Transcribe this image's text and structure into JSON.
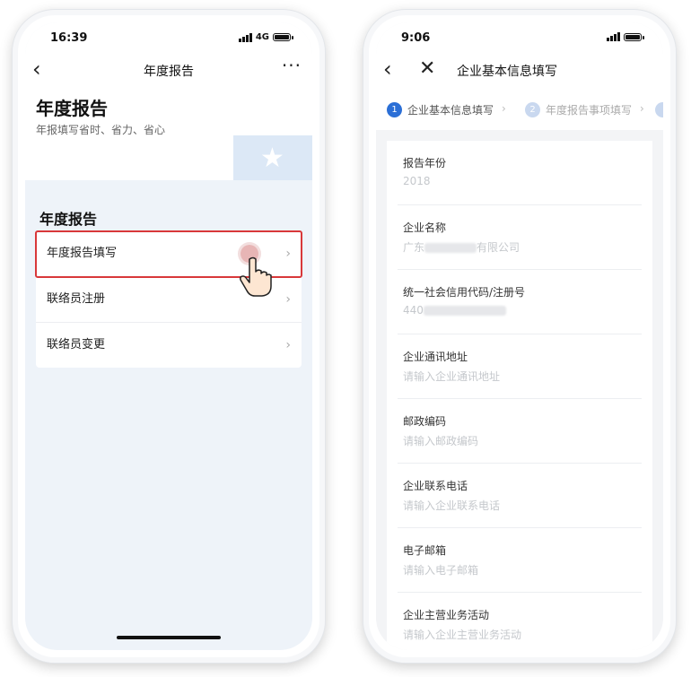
{
  "phone1": {
    "status": {
      "time": "16:39",
      "network": "4G"
    },
    "navbar": {
      "back_label": "‹",
      "title": "年度报告",
      "more_label": "···"
    },
    "hero": {
      "title": "年度报告",
      "subtitle": "年报填写省时、省力、省心"
    },
    "section_title": "年度报告",
    "menu": [
      {
        "label": "年度报告填写",
        "chevron": "›"
      },
      {
        "label": "联络员注册",
        "chevron": "›"
      },
      {
        "label": "联络员变更",
        "chevron": "›"
      }
    ],
    "icons": [
      "star-icon",
      "hand-pointer-icon"
    ],
    "accent": "#d8383a"
  },
  "phone2": {
    "status": {
      "time": "9:06"
    },
    "navbar": {
      "back_label": "‹",
      "close_label": "✕",
      "title": "企业基本信息填写"
    },
    "steps": [
      {
        "number": "1",
        "label": "企业基本信息填写"
      },
      {
        "number": "2",
        "label": "年度报告事项填写"
      }
    ],
    "step_separator": "›",
    "fields": [
      {
        "label": "报告年份",
        "value": "2018"
      },
      {
        "label": "企业名称",
        "value_prefix": "广东",
        "value_suffix": "有限公司"
      },
      {
        "label": "统一社会信用代码/注册号",
        "value_prefix": "440"
      },
      {
        "label": "企业通讯地址",
        "placeholder": "请输入企业通讯地址"
      },
      {
        "label": "邮政编码",
        "placeholder": "请输入邮政编码"
      },
      {
        "label": "企业联系电话",
        "placeholder": "请输入企业联系电话"
      },
      {
        "label": "电子邮箱",
        "placeholder": "请输入电子邮箱"
      },
      {
        "label": "企业主营业务活动",
        "placeholder": "请输入企业主营业务活动"
      }
    ],
    "accent": "#2b6fd6"
  }
}
